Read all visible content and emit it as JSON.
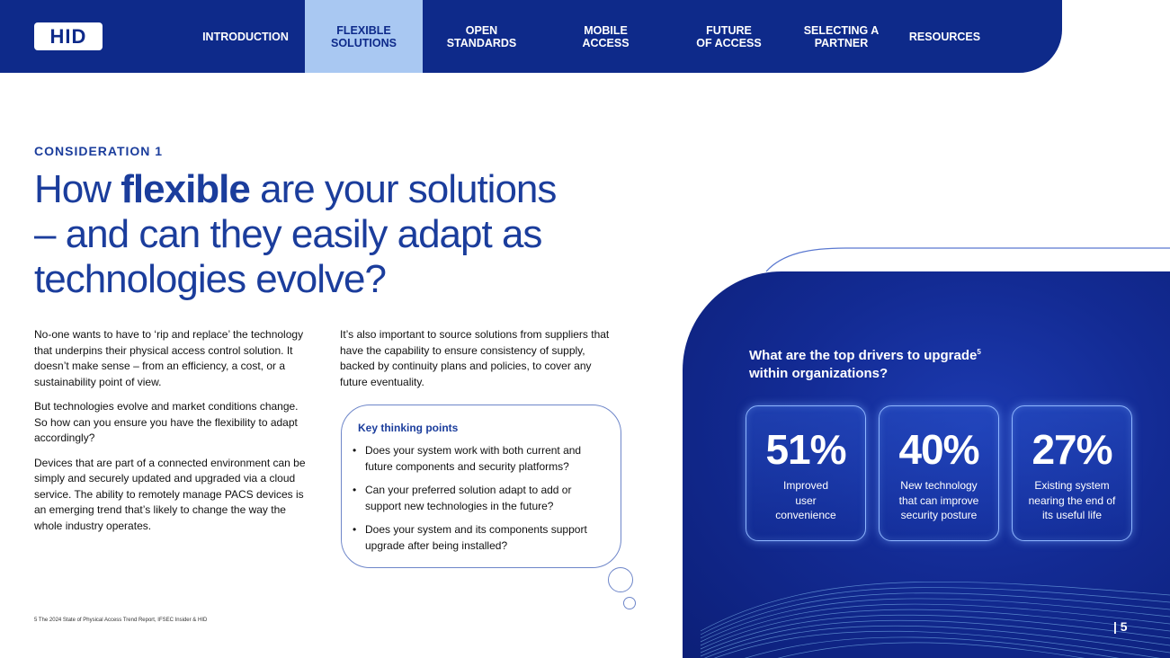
{
  "brand": {
    "logo_text": "HID"
  },
  "nav": {
    "items": [
      {
        "label": "INTRODUCTION"
      },
      {
        "label": "FLEXIBLE\nSOLUTIONS"
      },
      {
        "label": "OPEN\nSTANDARDS"
      },
      {
        "label": "MOBILE\nACCESS"
      },
      {
        "label": "FUTURE\nOF ACCESS"
      },
      {
        "label": "SELECTING A\nPARTNER"
      },
      {
        "label": "RESOURCES"
      }
    ],
    "active": "FLEXIBLE SOLUTIONS"
  },
  "section": {
    "eyebrow": "CONSIDERATION 1",
    "headline_pre": "How ",
    "headline_bold": "flexible",
    "headline_post": " are your solutions – and can they easily adapt as technologies evolve?"
  },
  "col1": [
    "No-one wants to have to ‘rip and replace’ the technology that underpins their physical access control solution. It doesn’t make sense – from an efficiency, a cost, or a sustainability point of view.",
    "But technologies evolve and market conditions change. So how can you ensure you have the flexibility to adapt accordingly?",
    "Devices that are part of a connected environment can be simply and securely updated and upgraded via a cloud service. The ability to remotely manage PACS devices is an emerging trend that’s likely to change the way the whole industry operates."
  ],
  "col2": [
    "It’s also important to source solutions from suppliers that have the capability to ensure consistency of supply, backed by continuity plans and policies, to cover any future eventuality."
  ],
  "thinking": {
    "title": "Key thinking points",
    "points": [
      "Does your system work with both current and future components and security platforms?",
      "Can your preferred solution adapt to add or support new technologies in the future?",
      "Does your system and its components support upgrade after being installed?"
    ]
  },
  "footnote": "5 The 2024 State of Physical Access Trend Report, IFSEC Insider & HID",
  "panel": {
    "question": "What are the top drivers to upgrade",
    "question_sup": "5",
    "question_line2": "within organizations?",
    "stats": [
      {
        "value": "51%",
        "label": "Improved\nuser\nconvenience"
      },
      {
        "value": "40%",
        "label": "New technology\nthat can improve\nsecurity posture"
      },
      {
        "value": "27%",
        "label": "Existing system\nnearing the end of\nits useful life"
      }
    ],
    "page_number": "| 5"
  },
  "colors": {
    "navy": "#0e2a8a",
    "accent_blue": "#1b3d9c",
    "active_tab": "#a9c8f2"
  }
}
